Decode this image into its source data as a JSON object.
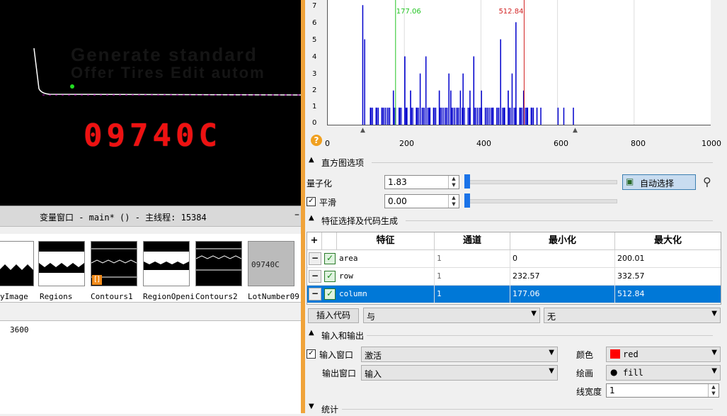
{
  "graphics": {
    "ghost_line1": "Generate standard",
    "ghost_line2": "Offer Tires Edit autom",
    "lot_number": "09740C"
  },
  "variable_window": {
    "title": "变量窗口 - main* () - 主线程: 15384",
    "close": "–",
    "thumbnails": [
      {
        "label": "yImage"
      },
      {
        "label": "Regions"
      },
      {
        "label": "Contours1"
      },
      {
        "label": "RegionOpeni"
      },
      {
        "label": "Contours2"
      },
      {
        "label": "LotNumber09"
      }
    ],
    "lot_thumb_text": "09740C",
    "control_value": "3600"
  },
  "histogram": {
    "y_ticks": [
      "7",
      "6",
      "5",
      "4",
      "3",
      "2",
      "1",
      "0"
    ],
    "x_ticks": [
      "0",
      "200",
      "400",
      "600",
      "800",
      "1000"
    ],
    "min_marker": "177.06",
    "max_marker": "512.84",
    "min_color": "#22c422",
    "max_color": "#d22222",
    "bar_color": "#0000cc"
  },
  "histogram_options": {
    "section": "直方图选项",
    "quantize_label": "量子化",
    "quantize_value": "1.83",
    "smooth_label": "平滑",
    "smooth_value": "0.00",
    "auto_select": "自动选择"
  },
  "feature_section": {
    "section": "特征选择及代码生成",
    "headers": {
      "plus": "+",
      "feature": "特征",
      "channel": "通道",
      "min": "最小化",
      "max": "最大化"
    },
    "rows": [
      {
        "feature": "area",
        "channel": "1",
        "min": "0",
        "max": "200.01",
        "selected": false
      },
      {
        "feature": "row",
        "channel": "1",
        "min": "232.57",
        "max": "332.57",
        "selected": false
      },
      {
        "feature": "column",
        "channel": "1",
        "min": "177.06",
        "max": "512.84",
        "selected": true
      }
    ],
    "insert_code": "插入代码",
    "combine_value": "与",
    "second_value": "无"
  },
  "io_section": {
    "section": "输入和输出",
    "input_window_label": "输入窗口",
    "input_window_value": "激活",
    "output_window_label": "输出窗口",
    "output_window_value": "输入",
    "color_label": "颜色",
    "color_value": "red",
    "color_swatch": "#ff0000",
    "draw_label": "绘画",
    "draw_value": "fill",
    "line_width_label": "线宽度",
    "line_width_value": "1"
  },
  "stats_section": {
    "section": "统计"
  }
}
